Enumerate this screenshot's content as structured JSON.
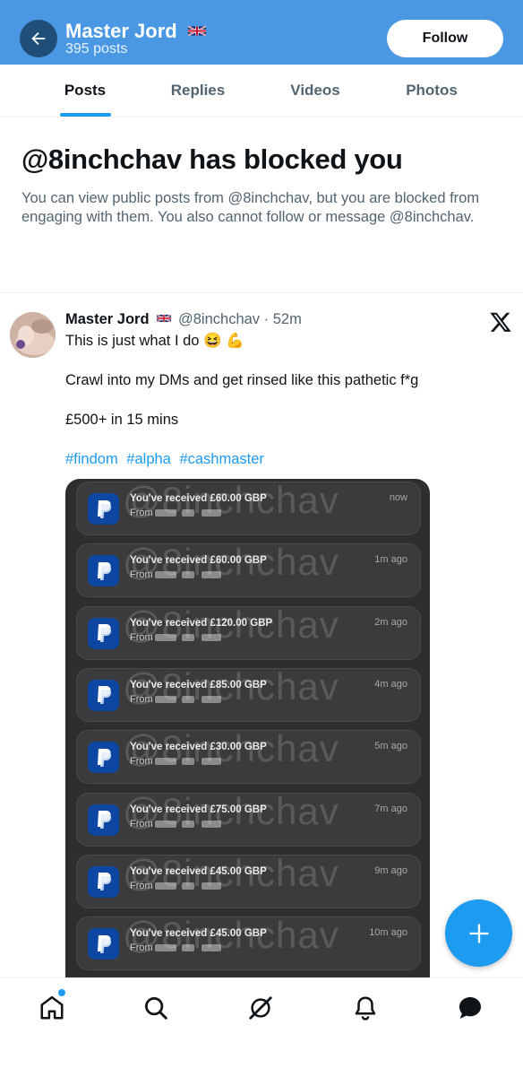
{
  "header": {
    "name": "Master Jord",
    "post_count": "395 posts",
    "follow_label": "Follow"
  },
  "tabs": [
    {
      "label": "Posts",
      "active": true
    },
    {
      "label": "Replies",
      "active": false
    },
    {
      "label": "Videos",
      "active": false
    },
    {
      "label": "Photos",
      "active": false
    }
  ],
  "blocked": {
    "title": "@8inchchav has blocked you",
    "description": "You can view public posts from @8inchchav, but you are blocked from engaging with them. You also cannot follow or message @8inchchav."
  },
  "post": {
    "author": "Master Jord",
    "handle_time": "@8inchchav · 52m",
    "line1": "This is just what I do 😆 💪",
    "line2": "Crawl into my DMs and get rinsed like this pathetic f*g",
    "line3": "£500+ in 15 mins",
    "hashtags": [
      "#findom",
      "#alpha",
      "#cashmaster"
    ],
    "media": {
      "watermark": "@8inchchav",
      "notifications": [
        {
          "title": "You've received £60.00 GBP",
          "from": "From",
          "time": "now"
        },
        {
          "title": "You've received £60.00 GBP",
          "from": "From",
          "time": "1m ago"
        },
        {
          "title": "You've received £120.00 GBP",
          "from": "From",
          "time": "2m ago"
        },
        {
          "title": "You've received £85.00 GBP",
          "from": "From",
          "time": "4m ago"
        },
        {
          "title": "You've received £30.00 GBP",
          "from": "From",
          "time": "5m ago"
        },
        {
          "title": "You've received £75.00 GBP",
          "from": "From",
          "time": "7m ago"
        },
        {
          "title": "You've received £45.00 GBP",
          "from": "From",
          "time": "9m ago"
        },
        {
          "title": "You've received £45.00 GBP",
          "from": "From",
          "time": "10m ago"
        }
      ]
    }
  },
  "icons": {
    "back": "back-arrow-icon",
    "flag": "uk-flag-icon",
    "x_logo": "x-logo-icon",
    "compose": "plus-icon",
    "nav": [
      "home-icon",
      "search-icon",
      "grok-icon",
      "bell-icon",
      "messages-icon"
    ]
  },
  "colors": {
    "header_bg": "#4a98e3",
    "accent": "#1d9bf0",
    "text": "#0f1419",
    "muted": "#536471"
  }
}
